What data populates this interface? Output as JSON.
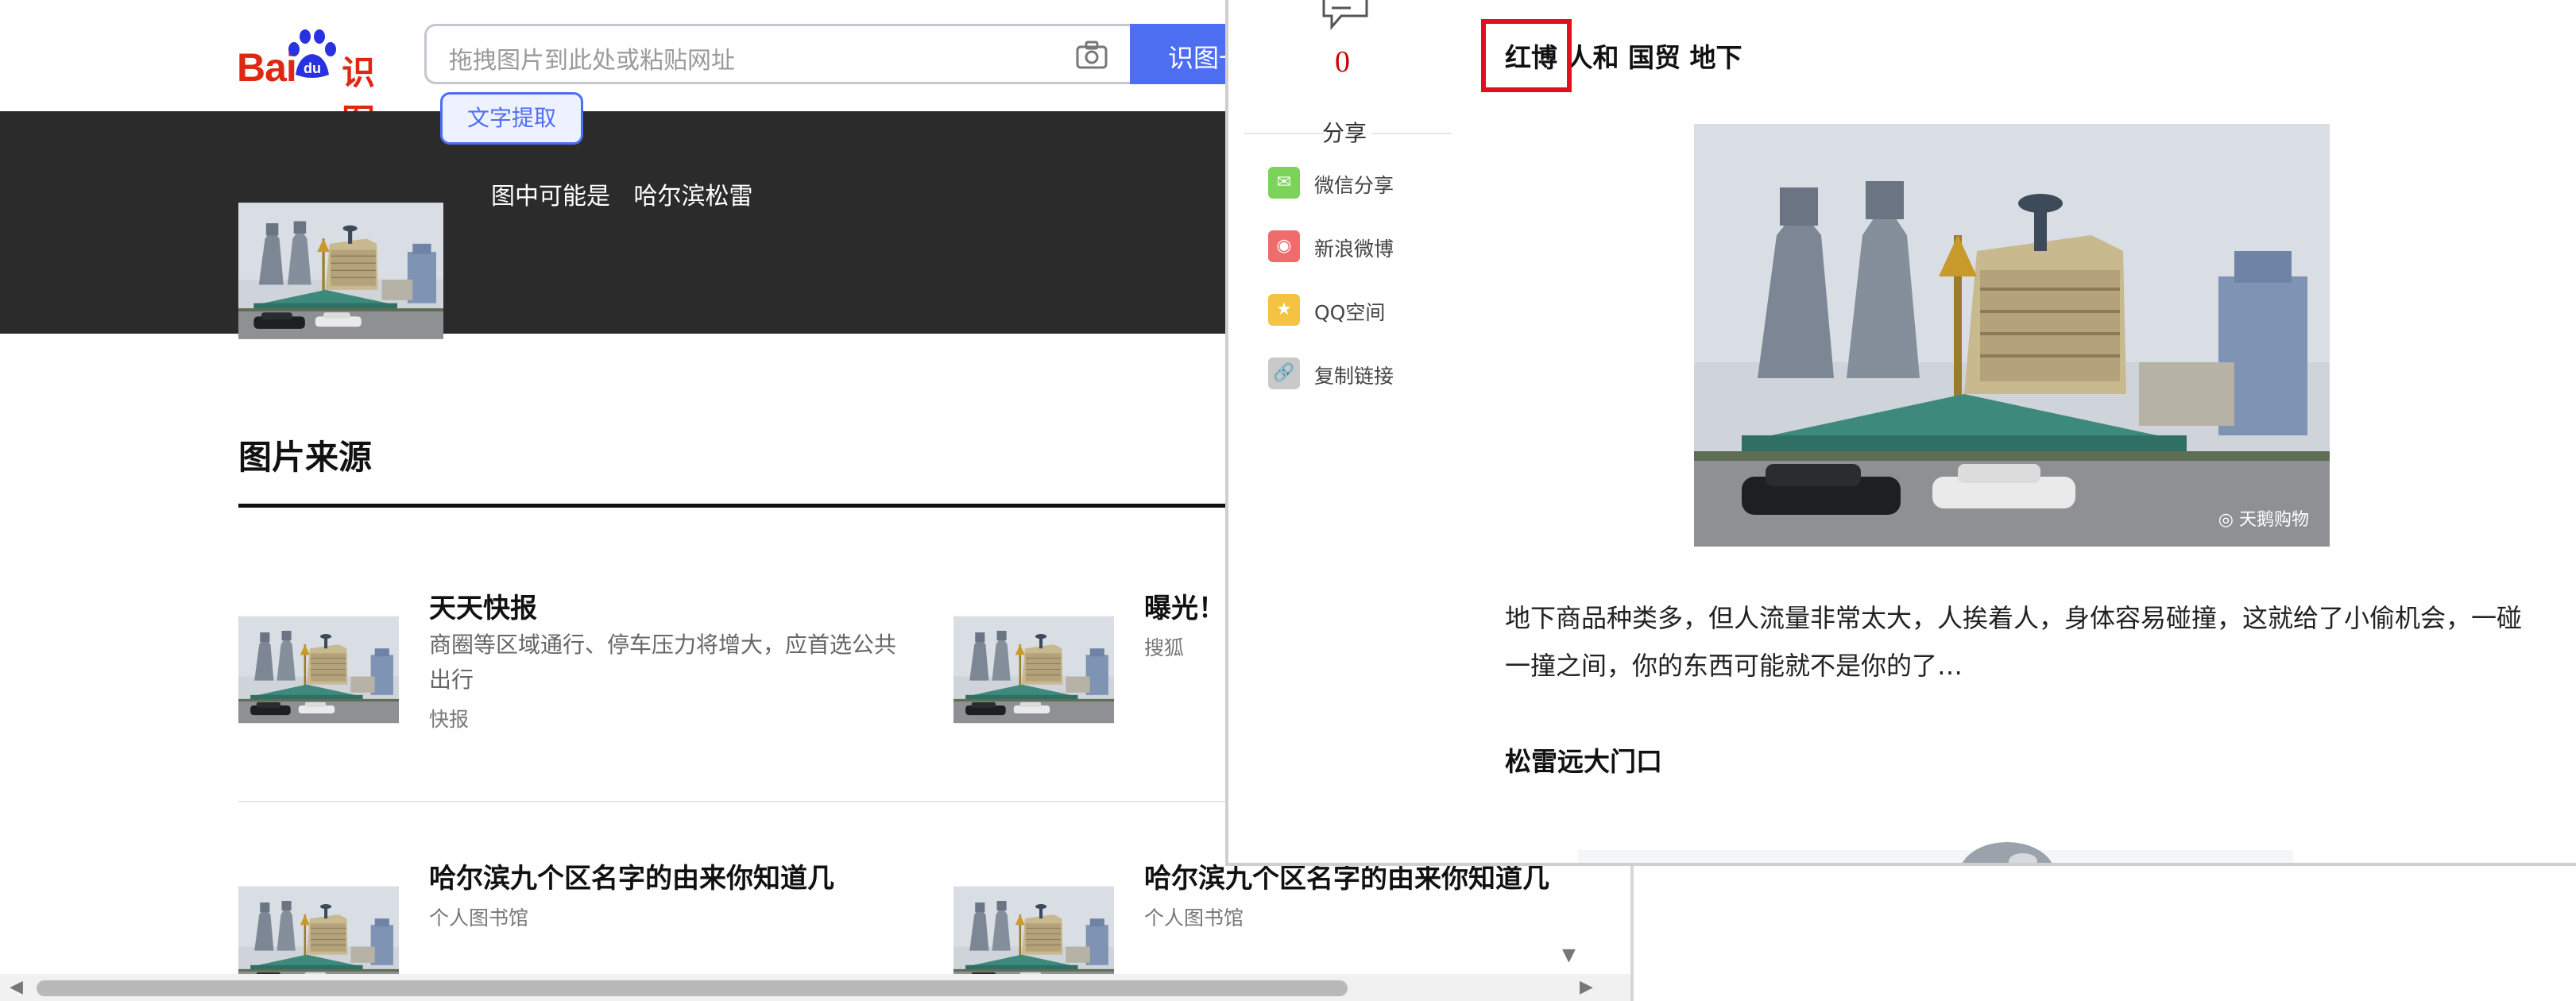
{
  "header": {
    "logo_bai": "Bai",
    "logo_du": "du",
    "logo_suffix": "识图",
    "search_placeholder": "拖拽图片到此处或粘贴网址",
    "search_button": "识图一下",
    "ocr_button": "文字提取"
  },
  "hero": {
    "prefix": "图中可能是",
    "guess": "哈尔滨松雷"
  },
  "sources": {
    "title": "图片来源",
    "items": [
      {
        "title": "天天快报",
        "desc": "商圈等区域通行、停车压力将增大，应首选公共出行",
        "source": "快报"
      },
      {
        "title": "曝光！",
        "desc": "",
        "source": "搜狐"
      },
      {
        "title": "哈尔滨九个区名字的由来你知道几",
        "desc": "",
        "source": "个人图书馆"
      },
      {
        "title": "哈尔滨九个区名字的由来你知道几",
        "desc": "",
        "source": "个人图书馆"
      }
    ]
  },
  "overlay": {
    "comment_count": "0",
    "share_title": "分享",
    "share_items": [
      {
        "label": "微信分享",
        "icon": "wechat-icon",
        "color": "#7bd35a"
      },
      {
        "label": "新浪微博",
        "icon": "weibo-icon",
        "color": "#f06b6b"
      },
      {
        "label": "QQ空间",
        "icon": "qzone-icon",
        "color": "#f5c342"
      },
      {
        "label": "复制链接",
        "icon": "link-icon",
        "color": "#c9c9c9"
      }
    ],
    "article": {
      "heading": "红博 人和 国贸 地下",
      "highlight": "红博",
      "image_watermark": "天鹅购物",
      "paragraph": "地下商品种类多，但人流量非常太大，人挨着人，身体容易碰撞，这就给了小偷机会，一碰一撞之间，你的东西可能就不是你的了…",
      "subheading": "松雷远大门口"
    }
  },
  "colors": {
    "brand_red": "#de2910",
    "brand_blue": "#4e6ef2",
    "dark_band": "#2b2b2b",
    "highlight_box": "#e0101c"
  }
}
